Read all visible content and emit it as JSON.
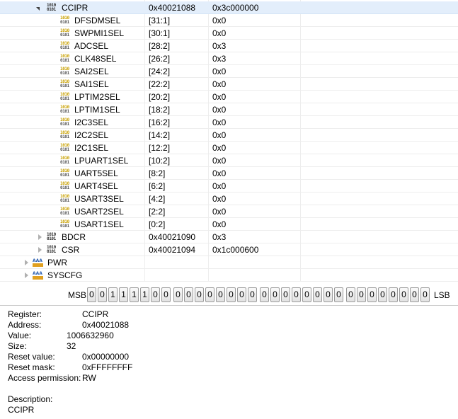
{
  "tree": {
    "register": {
      "name": "CCIPR",
      "address": "0x40021088",
      "value": "0x3c000000"
    },
    "fields": [
      {
        "name": "DFSDMSEL",
        "bits": "[31:1]",
        "value": "0x0"
      },
      {
        "name": "SWPMI1SEL",
        "bits": "[30:1]",
        "value": "0x0"
      },
      {
        "name": "ADCSEL",
        "bits": "[28:2]",
        "value": "0x3"
      },
      {
        "name": "CLK48SEL",
        "bits": "[26:2]",
        "value": "0x3"
      },
      {
        "name": "SAI2SEL",
        "bits": "[24:2]",
        "value": "0x0"
      },
      {
        "name": "SAI1SEL",
        "bits": "[22:2]",
        "value": "0x0"
      },
      {
        "name": "LPTIM2SEL",
        "bits": "[20:2]",
        "value": "0x0"
      },
      {
        "name": "LPTIM1SEL",
        "bits": "[18:2]",
        "value": "0x0"
      },
      {
        "name": "I2C3SEL",
        "bits": "[16:2]",
        "value": "0x0"
      },
      {
        "name": "I2C2SEL",
        "bits": "[14:2]",
        "value": "0x0"
      },
      {
        "name": "I2C1SEL",
        "bits": "[12:2]",
        "value": "0x0"
      },
      {
        "name": "LPUART1SEL",
        "bits": "[10:2]",
        "value": "0x0"
      },
      {
        "name": "UART5SEL",
        "bits": "[8:2]",
        "value": "0x0"
      },
      {
        "name": "UART4SEL",
        "bits": "[6:2]",
        "value": "0x0"
      },
      {
        "name": "USART3SEL",
        "bits": "[4:2]",
        "value": "0x0"
      },
      {
        "name": "USART2SEL",
        "bits": "[2:2]",
        "value": "0x0"
      },
      {
        "name": "USART1SEL",
        "bits": "[0:2]",
        "value": "0x0"
      }
    ],
    "siblings": [
      {
        "name": "BDCR",
        "address": "0x40021090",
        "value": "0x3"
      },
      {
        "name": "CSR",
        "address": "0x40021094",
        "value": "0x1c000600"
      }
    ],
    "peripherals": [
      {
        "name": "PWR"
      },
      {
        "name": "SYSCFG"
      }
    ]
  },
  "bitbar": {
    "msb_label": "MSB",
    "lsb_label": "LSB",
    "bits": [
      "0",
      "0",
      "1",
      "1",
      "1",
      "1",
      "0",
      "0",
      "0",
      "0",
      "0",
      "0",
      "0",
      "0",
      "0",
      "0",
      "0",
      "0",
      "0",
      "0",
      "0",
      "0",
      "0",
      "0",
      "0",
      "0",
      "0",
      "0",
      "0",
      "0",
      "0",
      "0"
    ]
  },
  "details": {
    "register_label": "Register:",
    "register": "CCIPR",
    "address_label": "Address:",
    "address": "0x40021088",
    "value_label": "Value:",
    "value": "1006632960",
    "size_label": "Size:",
    "size": "32",
    "reset_value_label": "Reset value:",
    "reset_value": "0x00000000",
    "reset_mask_label": "Reset mask:",
    "reset_mask": "0xFFFFFFFF",
    "access_label": "Access permission:",
    "access": "RW",
    "description_label": "Description:",
    "description": "CCIPR"
  },
  "icons": {
    "register_icon": "binary-register-icon",
    "field_icon": "binary-field-icon",
    "peripheral_icon": "peripheral-aaa-icon",
    "expanded": "triangle-down-icon",
    "collapsed": "triangle-right-icon"
  },
  "colors": {
    "selection": "#e3eefb",
    "grid": "#ededed"
  }
}
